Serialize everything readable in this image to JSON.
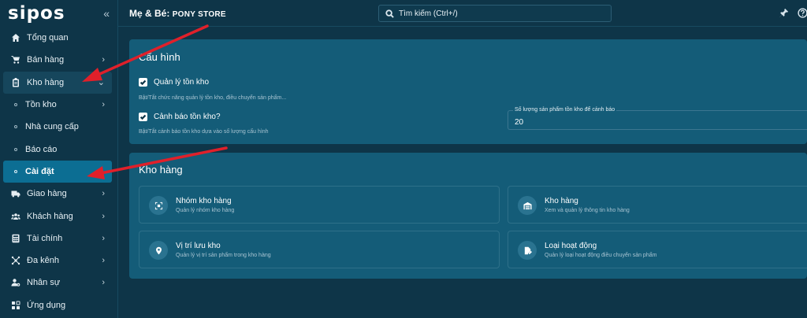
{
  "app": {
    "logo": "sipos",
    "collapse_icon": "double-chevron-left-icon"
  },
  "header": {
    "store_label": "Mẹ & Bé:",
    "store_name": "PONY STORE",
    "search_placeholder": "Tìm kiếm (Ctrl+/)"
  },
  "sidebar": {
    "items": [
      {
        "label": "Tổng quan",
        "icon": "home-icon"
      },
      {
        "label": "Bán hàng",
        "icon": "cart-icon"
      },
      {
        "label": "Kho hàng",
        "icon": "clipboard-icon"
      },
      {
        "label": "Tồn kho"
      },
      {
        "label": "Nhà cung cấp"
      },
      {
        "label": "Báo cáo"
      },
      {
        "label": "Cài đặt"
      },
      {
        "label": "Giao hàng",
        "icon": "truck-icon"
      },
      {
        "label": "Khách hàng",
        "icon": "users-icon"
      },
      {
        "label": "Tài chính",
        "icon": "calculator-icon"
      },
      {
        "label": "Đa kênh",
        "icon": "network-icon"
      },
      {
        "label": "Nhân sự",
        "icon": "user-gear-icon"
      },
      {
        "label": "Ứng dụng",
        "icon": "apps-icon"
      }
    ]
  },
  "config": {
    "title": "Cấu hình",
    "inventory_mgmt": {
      "label": "Quản lý tồn kho",
      "description": "Bật/Tắt chức năng quản lý tồn kho, điều chuyển sản phẩm...",
      "checked": true
    },
    "stock_alert": {
      "label": "Cảnh báo tồn kho?",
      "description": "Bật/Tắt cảnh báo tồn kho dựa vào số lượng cấu hình",
      "checked": true
    },
    "threshold": {
      "label": "Số lượng sản phẩm tồn kho để cảnh báo",
      "value": "20"
    }
  },
  "warehouse": {
    "title": "Kho hàng",
    "tiles": [
      {
        "name": "Nhóm kho hàng",
        "description": "Quản lý nhóm kho hàng",
        "icon": "group-icon"
      },
      {
        "name": "Kho hàng",
        "description": "Xem và quản lý thông tin kho hàng",
        "icon": "warehouse-icon"
      },
      {
        "name": "Vị trí lưu kho",
        "description": "Quản lý vị trí sản phẩm trong kho hàng",
        "icon": "location-pin-icon"
      },
      {
        "name": "Loại hoạt động",
        "description": "Quản lý loại hoạt động điều chuyển sản phẩm",
        "icon": "document-edit-icon"
      }
    ]
  },
  "colors": {
    "background": "#0e3548",
    "card": "#145c78",
    "active_item": "#0c6e93",
    "annotation_arrow": "#e0202a"
  }
}
